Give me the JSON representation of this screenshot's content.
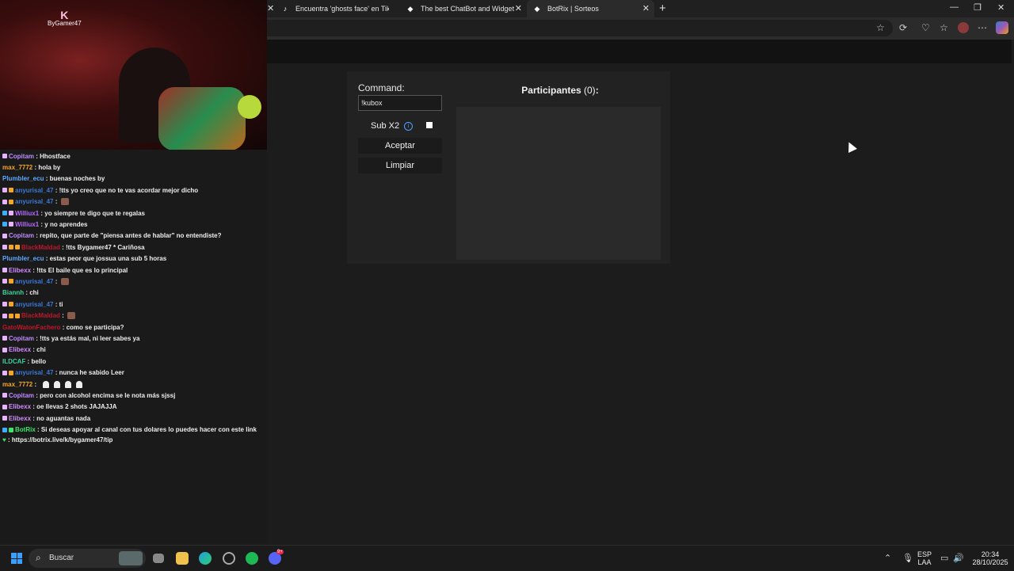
{
  "browser": {
    "tabs": [
      {
        "title": "Encuentra 'ghosts face' en TikTok",
        "icon": "tiktok-icon"
      },
      {
        "title": "The best ChatBot and Widgets fo",
        "icon": "botrix-icon"
      },
      {
        "title": "BotRix | Sorteos",
        "icon": "botrix-icon"
      }
    ]
  },
  "page": {
    "command_label": "Command:",
    "command_value": "!kubox",
    "sub_label": "Sub X2",
    "sub_checked": false,
    "accept_label": "Aceptar",
    "clear_label": "Limpiar",
    "participants_label": "Participantes",
    "participants_count": "(0)",
    "participants_suffix": ":"
  },
  "stream": {
    "logo_letter": "K",
    "logo_text": "ByGamer47"
  },
  "chat": {
    "messages": [
      {
        "user": "Copitam",
        "color": "#c08bff",
        "badges": [
          "#e9b3ff"
        ],
        "text": " : Hhostface"
      },
      {
        "user": "max_7772",
        "color": "#f5a623",
        "badges": [],
        "text": " : hola by"
      },
      {
        "user": "Plumbler_ecu",
        "color": "#5fa8ff",
        "badges": [],
        "text": " : buenas noches by"
      },
      {
        "user": "anyurisal_47",
        "color": "#3a78d8",
        "badges": [
          "#e9b3ff",
          "#f5a623"
        ],
        "text": " : !tts yo creo que no te vas acordar mejor dicho"
      },
      {
        "user": "anyurisal_47",
        "color": "#3a78d8",
        "badges": [
          "#e9b3ff",
          "#f5a623"
        ],
        "text": " : ",
        "emote": true
      },
      {
        "user": "Williux1",
        "color": "#b66bff",
        "badges": [
          "#3ab0ff",
          "#e9b3ff"
        ],
        "text": " : yo siempre te digo que te regalas"
      },
      {
        "user": "Williux1",
        "color": "#b66bff",
        "badges": [
          "#3ab0ff",
          "#e9b3ff"
        ],
        "text": " : y no aprendes"
      },
      {
        "user": "Copitam",
        "color": "#c08bff",
        "badges": [
          "#e9b3ff"
        ],
        "text": " : repito, que parte de \"piensa antes de hablar\" no entendiste?"
      },
      {
        "user": "BlackMaldad",
        "color": "#c0172b",
        "badges": [
          "#e9b3ff",
          "#f5a623",
          "#f5a623"
        ],
        "text": " : !tts Bygamer47 * Cariñosa"
      },
      {
        "user": "Plumbler_ecu",
        "color": "#5fa8ff",
        "badges": [],
        "text": " : estas peor que jossua una sub 5 horas"
      },
      {
        "user": "Elibexx",
        "color": "#d28bff",
        "badges": [
          "#e9b3ff"
        ],
        "text": " : !tts El baile que es lo principal"
      },
      {
        "user": "anyurisal_47",
        "color": "#3a78d8",
        "badges": [
          "#e9b3ff",
          "#f5a623"
        ],
        "text": " : ",
        "emote": true
      },
      {
        "user": "Biannh",
        "color": "#39d39d",
        "badges": [],
        "text": " : chi"
      },
      {
        "user": "anyurisal_47",
        "color": "#3a78d8",
        "badges": [
          "#e9b3ff",
          "#f5a623"
        ],
        "text": " : ti"
      },
      {
        "user": "BlackMaldad",
        "color": "#c0172b",
        "badges": [
          "#e9b3ff",
          "#f5a623",
          "#f5a623"
        ],
        "text": " : ",
        "emote": true
      },
      {
        "user": "GatoWatonFachero",
        "color": "#c0172b",
        "badges": [],
        "text": " : como se participa?"
      },
      {
        "user": "Copitam",
        "color": "#c08bff",
        "badges": [
          "#e9b3ff"
        ],
        "text": " : !tts ya estás mal, ni leer sabes ya"
      },
      {
        "user": "Elibexx",
        "color": "#d28bff",
        "badges": [
          "#e9b3ff"
        ],
        "text": " : chi"
      },
      {
        "user": "ILDCAF",
        "color": "#39d39d",
        "badges": [],
        "text": " : bello"
      },
      {
        "user": "anyurisal_47",
        "color": "#3a78d8",
        "badges": [
          "#e9b3ff",
          "#f5a623"
        ],
        "text": " : nunca he sabido Leer"
      },
      {
        "user": "max_7772",
        "color": "#f5a623",
        "badges": [],
        "text": " : ",
        "ghosts": 4
      },
      {
        "user": "Copitam",
        "color": "#c08bff",
        "badges": [
          "#e9b3ff"
        ],
        "text": " : pero con alcohol encima se le nota más sjssj"
      },
      {
        "user": "Elibexx",
        "color": "#d28bff",
        "badges": [
          "#e9b3ff"
        ],
        "text": " : oe llevas 2 shots JAJAJJA"
      },
      {
        "user": "Elibexx",
        "color": "#d28bff",
        "badges": [
          "#e9b3ff"
        ],
        "text": " : no aguantas nada"
      },
      {
        "user": "BotRix",
        "color": "#39e66b",
        "badges": [
          "#3ab0ff",
          "#39e66b"
        ],
        "text": " : Si deseas apoyar al canal con tus dolares lo puedes hacer con este link"
      }
    ],
    "continuation": " : https://botrix.live/k/bygamer47/tip"
  },
  "taskbar": {
    "search_placeholder": "Buscar",
    "lang_top": "ESP",
    "lang_bottom": "LAA",
    "time": "20:34",
    "date": "28/10/2025",
    "discord_badge": "9+"
  }
}
